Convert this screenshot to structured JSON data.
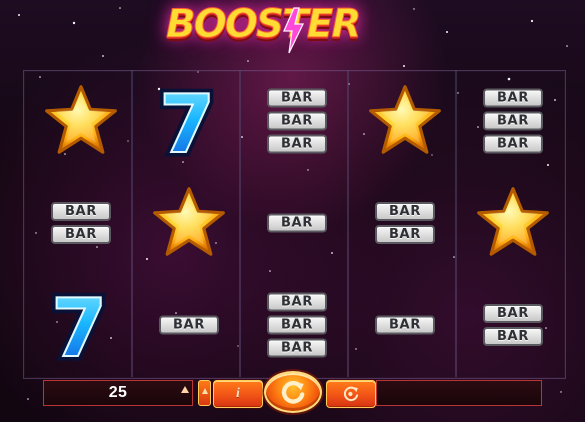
{
  "title": {
    "logo_text": "BOOSTER"
  },
  "reels": [
    [
      {
        "type": "star"
      },
      {
        "type": "bar",
        "count": 2,
        "text": "BAR"
      },
      {
        "type": "seven",
        "text": "7"
      }
    ],
    [
      {
        "type": "seven",
        "text": "7"
      },
      {
        "type": "star"
      },
      {
        "type": "bar",
        "count": 1,
        "text": "BAR"
      }
    ],
    [
      {
        "type": "bar",
        "count": 3,
        "text": "BAR"
      },
      {
        "type": "bar",
        "count": 1,
        "text": "BAR"
      },
      {
        "type": "bar",
        "count": 3,
        "text": "BAR"
      }
    ],
    [
      {
        "type": "star"
      },
      {
        "type": "bar",
        "count": 2,
        "text": "BAR"
      },
      {
        "type": "bar",
        "count": 1,
        "text": "BAR"
      }
    ],
    [
      {
        "type": "bar",
        "count": 3,
        "text": "BAR"
      },
      {
        "type": "star"
      },
      {
        "type": "bar",
        "count": 2,
        "text": "BAR"
      }
    ]
  ],
  "controls": {
    "bet_value": "25",
    "info_label": "i",
    "spin_icon": "spin-icon",
    "autoplay_icon": "autoplay-icon",
    "increase_icon": "up-arrow-icon"
  },
  "colors": {
    "accent_orange": "#f25617",
    "gold": "#ffcc57",
    "bar_text": "#2f3036"
  }
}
